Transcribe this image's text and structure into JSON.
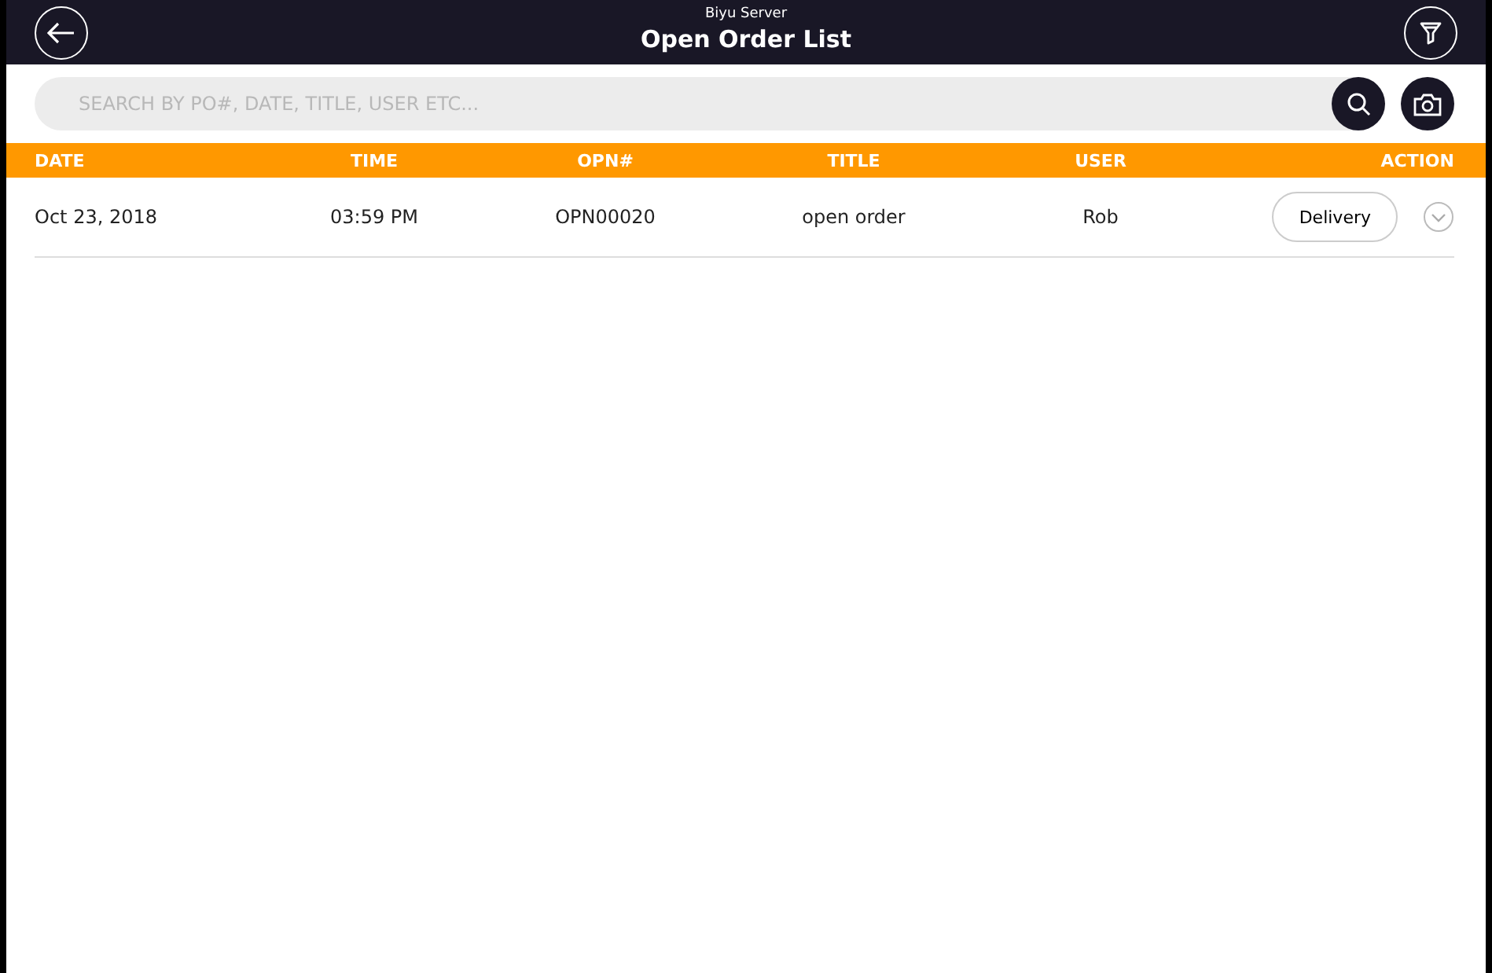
{
  "header": {
    "subtitle": "Biyu Server",
    "title": "Open Order List"
  },
  "search": {
    "placeholder": "SEARCH BY PO#, DATE, TITLE, USER ETC..."
  },
  "table": {
    "columns": [
      "DATE",
      "TIME",
      "OPN#",
      "TITLE",
      "USER",
      "ACTION"
    ],
    "rows": [
      {
        "date": "Oct 23, 2018",
        "time": "03:59 PM",
        "opn": "OPN00020",
        "title": "open order",
        "user": "Rob",
        "action": "Delivery"
      }
    ]
  }
}
